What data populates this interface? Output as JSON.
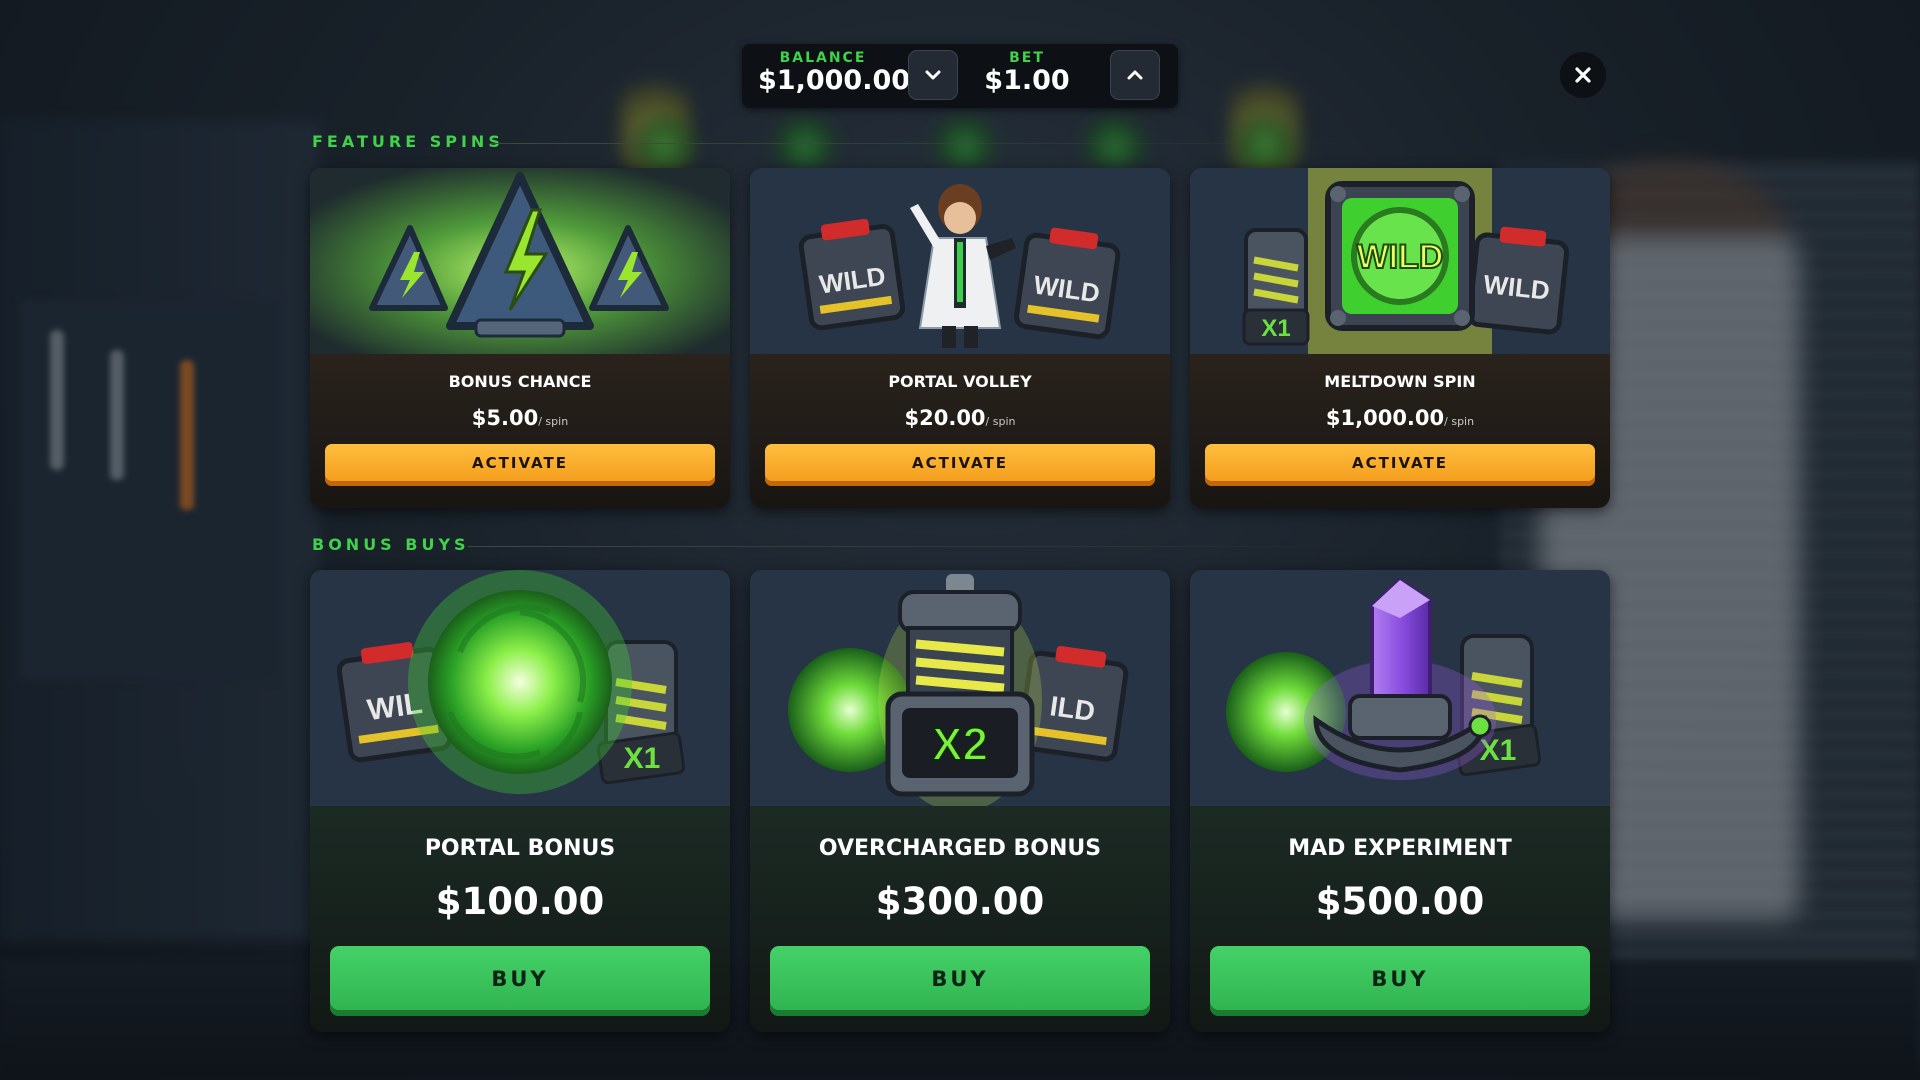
{
  "header": {
    "balance_label": "BALANCE",
    "balance_value": "$1,000.00",
    "bet_label": "BET",
    "bet_value": "$1.00",
    "decrease_icon": "chevron-down-icon",
    "increase_icon": "chevron-up-icon",
    "close_icon": "close-icon"
  },
  "feature_spins": {
    "title": "FEATURE SPINS",
    "cards": [
      {
        "name": "BONUS CHANCE",
        "price": "$5.00",
        "unit": "/ spin",
        "button": "ACTIVATE"
      },
      {
        "name": "PORTAL VOLLEY",
        "price": "$20.00",
        "unit": "/ spin",
        "button": "ACTIVATE"
      },
      {
        "name": "MELTDOWN SPIN",
        "price": "$1,000.00",
        "unit": "/ spin",
        "button": "ACTIVATE"
      }
    ]
  },
  "bonus_buys": {
    "title": "BONUS BUYS",
    "cards": [
      {
        "name": "PORTAL BONUS",
        "price": "$100.00",
        "button": "BUY"
      },
      {
        "name": "OVERCHARGED BONUS",
        "price": "$300.00",
        "button": "BUY"
      },
      {
        "name": "MAD EXPERIMENT",
        "price": "$500.00",
        "button": "BUY"
      }
    ]
  },
  "art_text": {
    "wild": "WILD",
    "wil": "WIL",
    "ild": "ILD",
    "x1": "X1",
    "x2": "X2"
  },
  "colors": {
    "accent_green": "#3fd24a",
    "activate_orange": "#f7a224",
    "buy_green": "#3cc25d",
    "panel_dark": "#0d1116"
  }
}
